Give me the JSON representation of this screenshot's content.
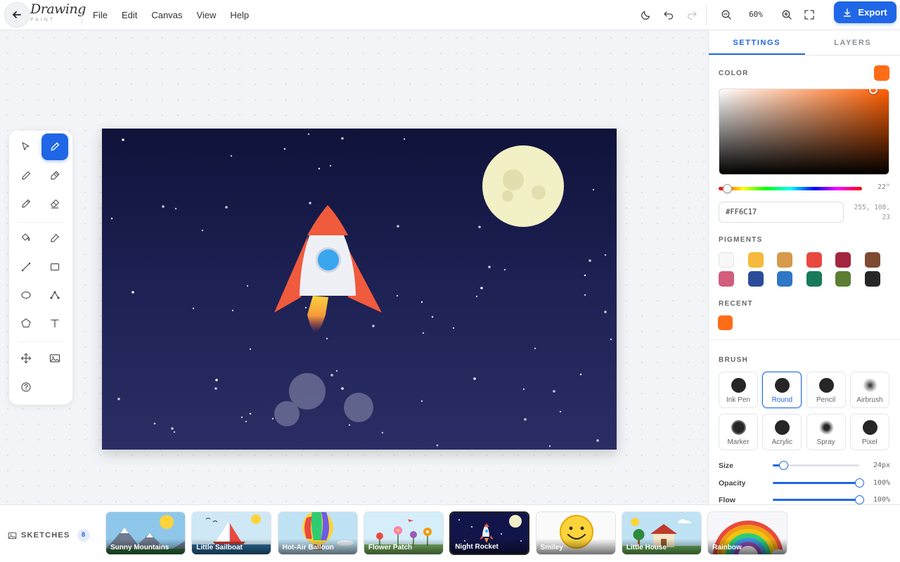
{
  "app": {
    "logo_main": "Drawing",
    "logo_sub": "PAINT"
  },
  "menu": [
    "File",
    "Edit",
    "Canvas",
    "View",
    "Help"
  ],
  "toolbar": {
    "zoom": "60%",
    "export_label": "Export"
  },
  "tools": [
    {
      "name": "select-tool",
      "icon": "cursor-icon"
    },
    {
      "name": "brush-tool",
      "icon": "brush-icon",
      "active": true
    },
    {
      "name": "pencil-tool",
      "icon": "pencil-icon"
    },
    {
      "name": "marker-tool",
      "icon": "marker-icon"
    },
    {
      "name": "pen-tool",
      "icon": "pen-icon"
    },
    {
      "name": "eraser-tool",
      "icon": "eraser-icon"
    },
    {
      "name": "fill-tool",
      "icon": "paint-bucket-icon"
    },
    {
      "name": "eyedropper-tool",
      "icon": "eyedropper-icon"
    },
    {
      "name": "line-tool",
      "icon": "line-icon"
    },
    {
      "name": "rectangle-tool",
      "icon": "rectangle-icon"
    },
    {
      "name": "ellipse-tool",
      "icon": "ellipse-icon"
    },
    {
      "name": "bezier-tool",
      "icon": "bezier-icon"
    },
    {
      "name": "polygon-tool",
      "icon": "pentagon-icon"
    },
    {
      "name": "text-tool",
      "icon": "text-icon"
    },
    {
      "name": "move-tool",
      "icon": "move-icon"
    },
    {
      "name": "image-tool",
      "icon": "image-icon"
    },
    {
      "name": "help-tool",
      "icon": "help-icon"
    }
  ],
  "panel": {
    "tabs": [
      {
        "label": "SETTINGS",
        "active": true
      },
      {
        "label": "LAYERS",
        "active": false
      }
    ],
    "color": {
      "title": "COLOR",
      "current": "#FF6C17",
      "hex": "#FF6C17",
      "hue_value": "22°",
      "hue_fraction": 0.061,
      "rgb_text": "255, 108, 23"
    },
    "pigments_title": "PIGMENTS",
    "pigments": [
      "#f7f7f7",
      "#f6b93b",
      "#d69a4a",
      "#e9483f",
      "#a3263e",
      "#7e4a30",
      "#d35d7d",
      "#2b4c9b",
      "#2e77c6",
      "#187a5a",
      "#5d7d32",
      "#262626"
    ],
    "recent_title": "RECENT",
    "recent": [
      "#ff6c17"
    ],
    "brush_title": "BRUSH",
    "brushes": [
      {
        "label": "Ink Pen",
        "style": "solid"
      },
      {
        "label": "Round",
        "style": "solid",
        "active": true
      },
      {
        "label": "Pencil",
        "style": "solid"
      },
      {
        "label": "Airbrush",
        "style": "soft"
      },
      {
        "label": "Marker",
        "style": "marker"
      },
      {
        "label": "Acrylic",
        "style": "solid"
      },
      {
        "label": "Spray",
        "style": "spray"
      },
      {
        "label": "Pixel",
        "style": "solid"
      }
    ],
    "sliders": [
      {
        "label": "Size",
        "value": "24px",
        "fraction": 0.12
      },
      {
        "label": "Opacity",
        "value": "100%",
        "fraction": 1.0
      },
      {
        "label": "Flow",
        "value": "100%",
        "fraction": 1.0
      }
    ]
  },
  "sketches": {
    "label": "SKETCHES",
    "count": "8",
    "items": [
      {
        "label": "Sunny Mountains",
        "scene": "mountains"
      },
      {
        "label": "Little Sailboat",
        "scene": "sailboat"
      },
      {
        "label": "Hot-Air Balloon",
        "scene": "balloon"
      },
      {
        "label": "Flower Patch",
        "scene": "flowers"
      },
      {
        "label": "Night Rocket",
        "scene": "rocket",
        "active": true
      },
      {
        "label": "Smiley",
        "scene": "smiley"
      },
      {
        "label": "Little House",
        "scene": "house"
      },
      {
        "label": "Rainbow",
        "scene": "rainbow"
      }
    ]
  },
  "colors": {
    "accent": "#1f67e6",
    "rocket_red": "#f05a3d",
    "moon": "#f2f0c5",
    "window": "#3aa6f0"
  }
}
